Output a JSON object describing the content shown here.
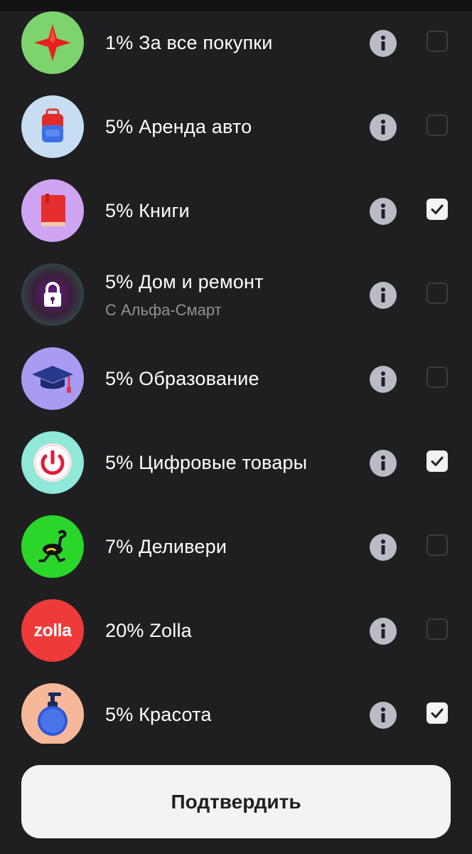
{
  "items": [
    {
      "label": "1% За все покупки",
      "sublabel": "",
      "icon": "red-star-icon",
      "checked": false
    },
    {
      "label": "5% Аренда авто",
      "sublabel": "",
      "icon": "suitcase-icon",
      "checked": false
    },
    {
      "label": "5% Книги",
      "sublabel": "",
      "icon": "book-icon",
      "checked": true
    },
    {
      "label": "5% Дом и ремонт",
      "sublabel": "С Альфа-Смарт",
      "icon": "lock-icon",
      "checked": false
    },
    {
      "label": "5% Образование",
      "sublabel": "",
      "icon": "graduation-cap-icon",
      "checked": false
    },
    {
      "label": "5% Цифровые товары",
      "sublabel": "",
      "icon": "power-icon",
      "checked": true
    },
    {
      "label": "7% Деливери",
      "sublabel": "",
      "icon": "ostrich-icon",
      "checked": false
    },
    {
      "label": "20% Zolla",
      "sublabel": "",
      "icon": "zolla-logo-icon",
      "logo_text": "zolla",
      "checked": false
    },
    {
      "label": "5% Красота",
      "sublabel": "",
      "icon": "soap-bottle-icon",
      "checked": true
    }
  ],
  "confirm_label": "Подтвердить",
  "colors": {
    "background": "#1f1f21",
    "button": "#f2f3f5",
    "info": "#b9bcc3",
    "sublabel": "#8f8f96"
  }
}
